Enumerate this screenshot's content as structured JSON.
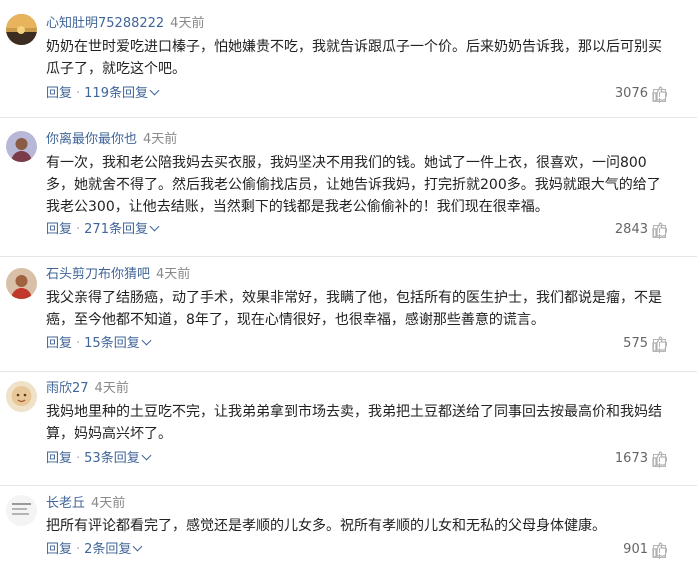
{
  "comments": [
    {
      "username": "心知肚明75288222",
      "time": "4天前",
      "lines": [
        "奶奶在世时爱吃进口榛子，怕她嫌贵不吃，我就告诉跟瓜子一个价。后来奶奶告诉我，那以后可别买",
        "瓜子了，就吃这个吧。"
      ],
      "reply_label": "回复",
      "replies_label": "119条回复",
      "likes": "3076",
      "avatar": "sunset-avatar"
    },
    {
      "username": "你离最你最你也",
      "time": "4天前",
      "lines": [
        "有一次，我和老公陪我妈去买衣服，我妈坚决不用我们的钱。她试了一件上衣，很喜欢，一问800",
        "多，她就舍不得了。然后我老公偷偷找店员，让她告诉我妈，打完折就200多。我妈就跟大气的给了",
        "我老公300，让他去结账，当然剩下的钱都是我老公偷偷补的！我们现在很幸福。"
      ],
      "reply_label": "回复",
      "replies_label": "271条回复",
      "likes": "2843",
      "avatar": "person-avatar"
    },
    {
      "username": "石头剪刀布你猜吧",
      "time": "4天前",
      "lines": [
        "我父亲得了结肠癌，动了手术，效果非常好，我瞒了他，包括所有的医生护士，我们都说是瘤，不是",
        "癌，至今他都不知道，8年了，现在心情很好，也很幸福，感谢那些善意的谎言。"
      ],
      "reply_label": "回复",
      "replies_label": "15条回复",
      "likes": "575",
      "avatar": "person2-avatar"
    },
    {
      "username": "雨欣27",
      "time": "4天前",
      "lines": [
        "我妈地里种的土豆吃不完，让我弟弟拿到市场去卖，我弟把土豆都送给了同事回去按最高价和我妈结",
        "算，妈妈高兴坏了。"
      ],
      "reply_label": "回复",
      "replies_label": "53条回复",
      "likes": "1673",
      "avatar": "cartoon-avatar"
    },
    {
      "username": "长老丘",
      "time": "4天前",
      "lines": [
        "把所有评论都看完了，感觉还是孝顺的儿女多。祝所有孝顺的儿女和无私的父母身体健康。"
      ],
      "reply_label": "回复",
      "replies_label": "2条回复",
      "likes": "901",
      "avatar": "doc-avatar"
    }
  ],
  "colors": {
    "link": "#406599",
    "meta": "#8a8a8a",
    "text": "#222222"
  }
}
